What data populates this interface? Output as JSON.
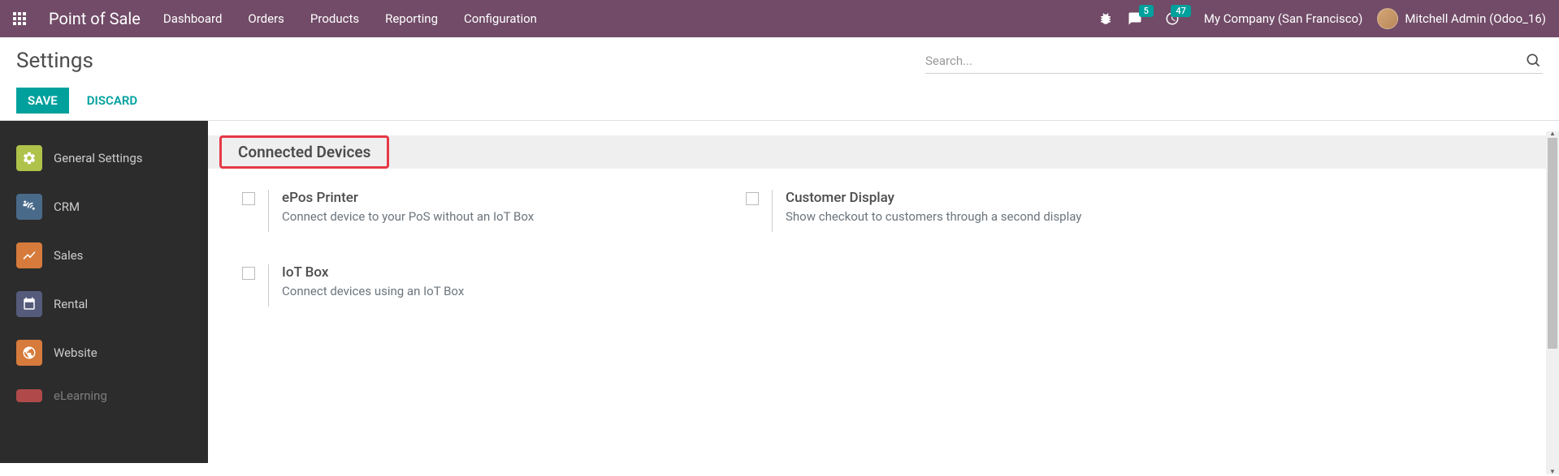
{
  "navbar": {
    "app_title": "Point of Sale",
    "menu": [
      "Dashboard",
      "Orders",
      "Products",
      "Reporting",
      "Configuration"
    ],
    "messages_badge": "5",
    "activities_badge": "47",
    "company": "My Company (San Francisco)",
    "user": "Mitchell Admin (Odoo_16)"
  },
  "control_panel": {
    "title": "Settings",
    "save_label": "SAVE",
    "discard_label": "DISCARD",
    "search_placeholder": "Search..."
  },
  "sidebar": {
    "items": [
      {
        "label": "General Settings",
        "color": "#afc24a"
      },
      {
        "label": "CRM",
        "color": "#4a6a8a"
      },
      {
        "label": "Sales",
        "color": "#d67b3c"
      },
      {
        "label": "Rental",
        "color": "#555b7a"
      },
      {
        "label": "Website",
        "color": "#d67b3c"
      },
      {
        "label": "eLearning",
        "color": "#b04a4a"
      }
    ]
  },
  "content": {
    "section_title": "Connected Devices",
    "settings": [
      {
        "label": "ePos Printer",
        "desc": "Connect device to your PoS without an IoT Box"
      },
      {
        "label": "Customer Display",
        "desc": "Show checkout to customers through a second display"
      },
      {
        "label": "IoT Box",
        "desc": "Connect devices using an IoT Box"
      }
    ]
  }
}
